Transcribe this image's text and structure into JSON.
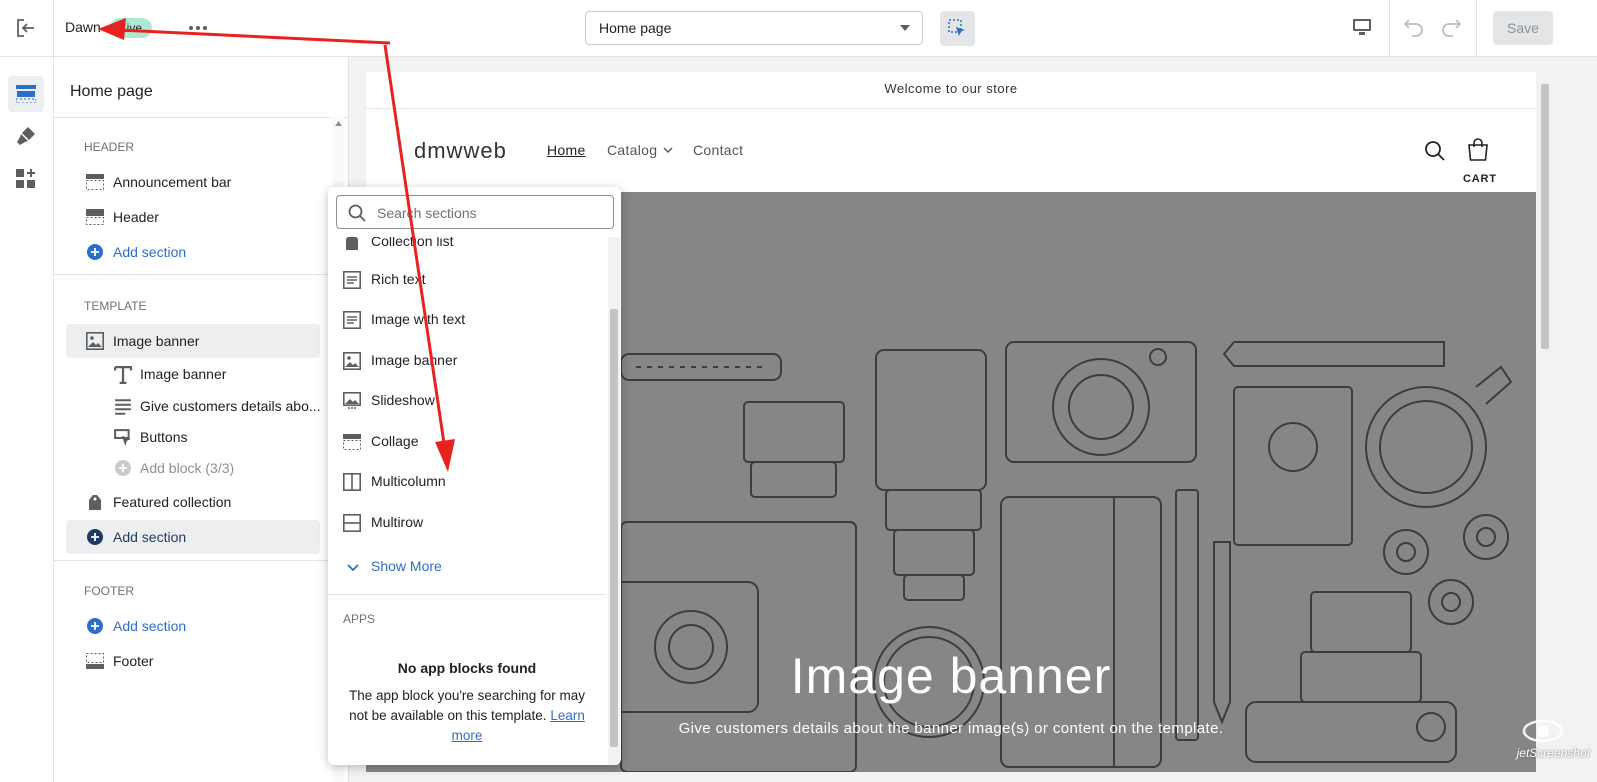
{
  "topbar": {
    "theme_name": "Dawn",
    "status_badge": "Live",
    "page_select": "Home page",
    "save_label": "Save"
  },
  "sidebar": {
    "title": "Home page",
    "header_label": "HEADER",
    "template_label": "TEMPLATE",
    "footer_label": "FOOTER",
    "header_items": [
      "Announcement bar",
      "Header"
    ],
    "add_section": "Add section",
    "template_items": {
      "image_banner": "Image banner",
      "blocks": [
        "Image banner",
        "Give customers details abo...",
        "Buttons"
      ],
      "add_block": "Add block (3/3)",
      "featured_collection": "Featured collection"
    },
    "footer_item": "Footer"
  },
  "popover": {
    "search_placeholder": "Search sections",
    "items": [
      "Collection list",
      "Rich text",
      "Image with text",
      "Image banner",
      "Slideshow",
      "Collage",
      "Multicolumn",
      "Multirow"
    ],
    "show_more": "Show More",
    "apps_label": "APPS",
    "no_apps_title": "No app blocks found",
    "no_apps_text": "The app block you're searching for may not be available on this template.",
    "learn_more": "Learn more"
  },
  "preview": {
    "announcement": "Welcome to our store",
    "store_name": "dmwweb",
    "nav": [
      "Home",
      "Catalog",
      "Contact"
    ],
    "cart_label": "CART",
    "banner_title": "Image banner",
    "banner_text": "Give customers details about the banner image(s) or content on the template."
  },
  "watermark": "jetScreenshot",
  "colors": {
    "accent": "#2c6ecb",
    "badge": "#aee9d1",
    "arrow": "#e8231f"
  }
}
